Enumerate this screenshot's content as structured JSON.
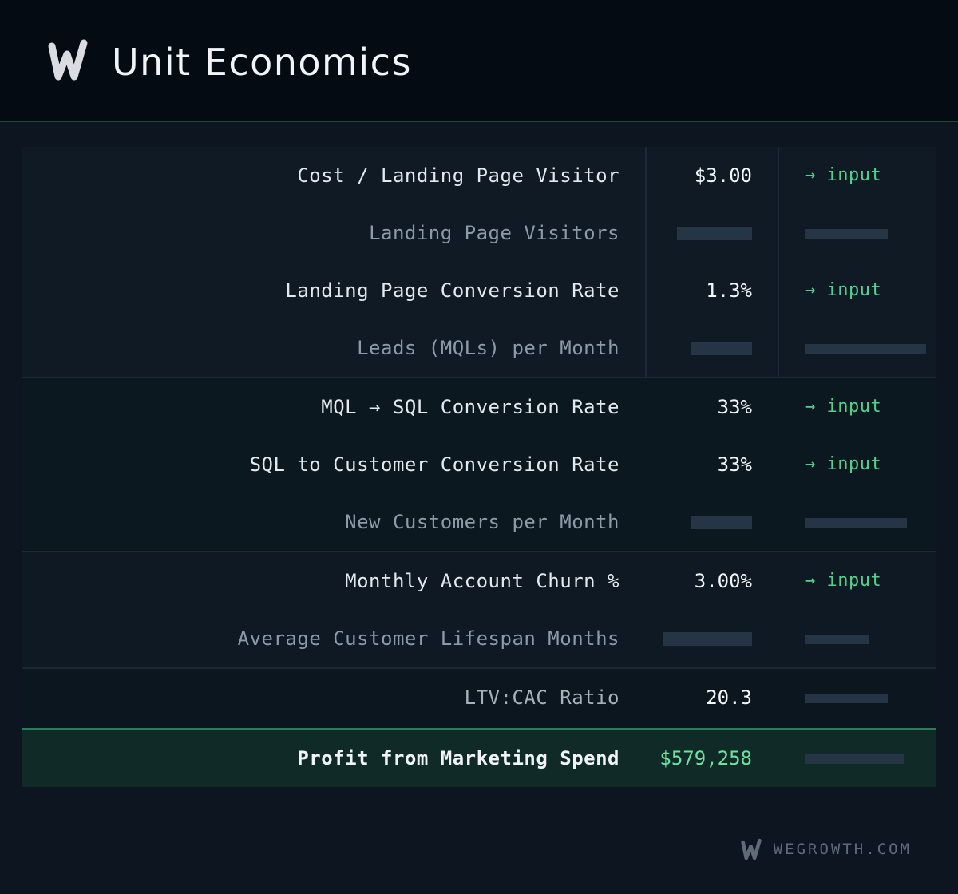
{
  "header": {
    "title": "Unit Economics",
    "logo_icon": "w-logo-icon"
  },
  "rows": [
    {
      "label": "Cost / Landing Page Visitor",
      "value": "$3.00",
      "note": "→ input"
    },
    {
      "label": "Landing Page Visitors"
    },
    {
      "label": "Landing Page Conversion Rate",
      "value": "1.3%",
      "note": "→ input"
    },
    {
      "label": "Leads (MQLs) per Month"
    },
    {
      "label": "MQL → SQL Conversion Rate",
      "value": "33%",
      "note": "→ input"
    },
    {
      "label": "SQL to Customer Conversion Rate",
      "value": "33%",
      "note": "→ input"
    },
    {
      "label": "New Customers per Month"
    },
    {
      "label": "Monthly Account Churn %",
      "value": "3.00%",
      "note": "→ input"
    },
    {
      "label": "Average Customer Lifespan Months"
    },
    {
      "label": "LTV:CAC Ratio",
      "value": "20.3"
    },
    {
      "label": "Profit from Marketing Spend",
      "value": "$579,258"
    }
  ],
  "footer": {
    "brand": "WEGROWTH.COM",
    "logo_icon": "w-logo-icon"
  },
  "colors": {
    "accent_green": "#4fd38c",
    "profit_green": "#6ee2a0",
    "background": "#0c1520",
    "header_bg": "#050b13"
  }
}
